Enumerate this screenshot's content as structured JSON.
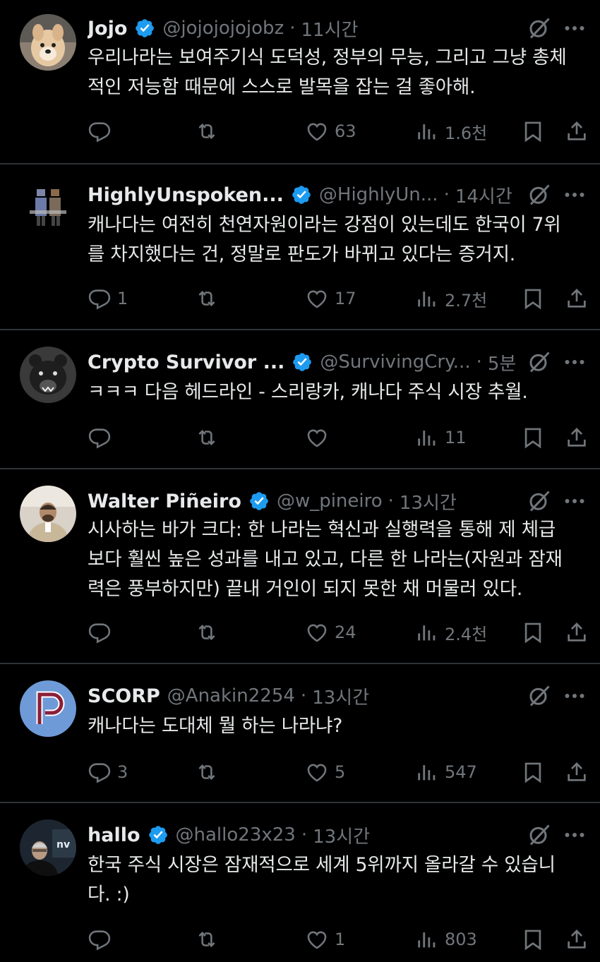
{
  "tweets": [
    {
      "name": "Jojo",
      "verified": true,
      "handle": "@jojojojojobz",
      "time": "11시간",
      "text": "우리나라는 보여주기식 도덕성, 정부의 무능, 그리고 그냥 총체적인 저능함 때문에 스스로 발목을 잡는 걸 좋아해.",
      "lines": [
        "우리나라는 보여주기식 도덕성, 정부의 무능, 그리고 그냥 총체",
        "적인 저능함 때문에 스스로 발목을 잡는 걸 좋아해."
      ],
      "replies": "",
      "retweets": "",
      "likes": "63",
      "views": "1.6천"
    },
    {
      "name": "HighlyUnspoken...",
      "verified": true,
      "handle": "@HighlyUn...",
      "time": "14시간",
      "lines": [
        "캐나다는 여전히 천연자원이라는 강점이 있는데도 한국이 7위",
        "를 차지했다는 건, 정말로 판도가 바뀌고 있다는 증거지."
      ],
      "replies": "1",
      "retweets": "",
      "likes": "17",
      "views": "2.7천"
    },
    {
      "name": "Crypto Survivor ...",
      "verified": true,
      "handle": "@SurvivingCry...",
      "time": "5분",
      "lines": [
        "ㅋㅋㅋ 다음 헤드라인 - 스리랑카, 캐나다 주식 시장 추월."
      ],
      "replies": "",
      "retweets": "",
      "likes": "",
      "views": "11"
    },
    {
      "name": "Walter Piñeiro",
      "verified": true,
      "handle": "@w_pineiro",
      "time": "13시간",
      "lines": [
        "시사하는 바가 크다: 한 나라는 혁신과 실행력을 통해 제 체급",
        "보다 훨씬 높은 성과를 내고 있고, 다른 한 나라는(자원과 잠재",
        "력은 풍부하지만) 끝내 거인이 되지 못한 채 머물러 있다."
      ],
      "replies": "",
      "retweets": "",
      "likes": "24",
      "views": "2.4천"
    },
    {
      "name": "SCORP",
      "verified": false,
      "handle": "@Anakin2254",
      "time": "13시간",
      "lines": [
        "캐나다는 도대체 뭘 하는 나라냐?"
      ],
      "replies": "3",
      "retweets": "",
      "likes": "5",
      "views": "547"
    },
    {
      "name": "hallo",
      "verified": true,
      "handle": "@hallo23x23",
      "time": "13시간",
      "lines": [
        "한국 주식 시장은 잠재적으로 세계 5위까지 올라갈 수 있습니",
        "다. :)"
      ],
      "replies": "",
      "retweets": "",
      "likes": "1",
      "views": "803"
    }
  ],
  "separator": "·",
  "colors": {
    "background": "#000000",
    "text": "#e7e9ea",
    "muted": "#71767b",
    "verified": "#1d9bf0",
    "divider": "#2f3336"
  },
  "icons": [
    "verified-badge-icon",
    "grok-icon",
    "more-icon",
    "reply-icon",
    "retweet-icon",
    "like-icon",
    "views-icon",
    "bookmark-icon",
    "share-icon"
  ]
}
